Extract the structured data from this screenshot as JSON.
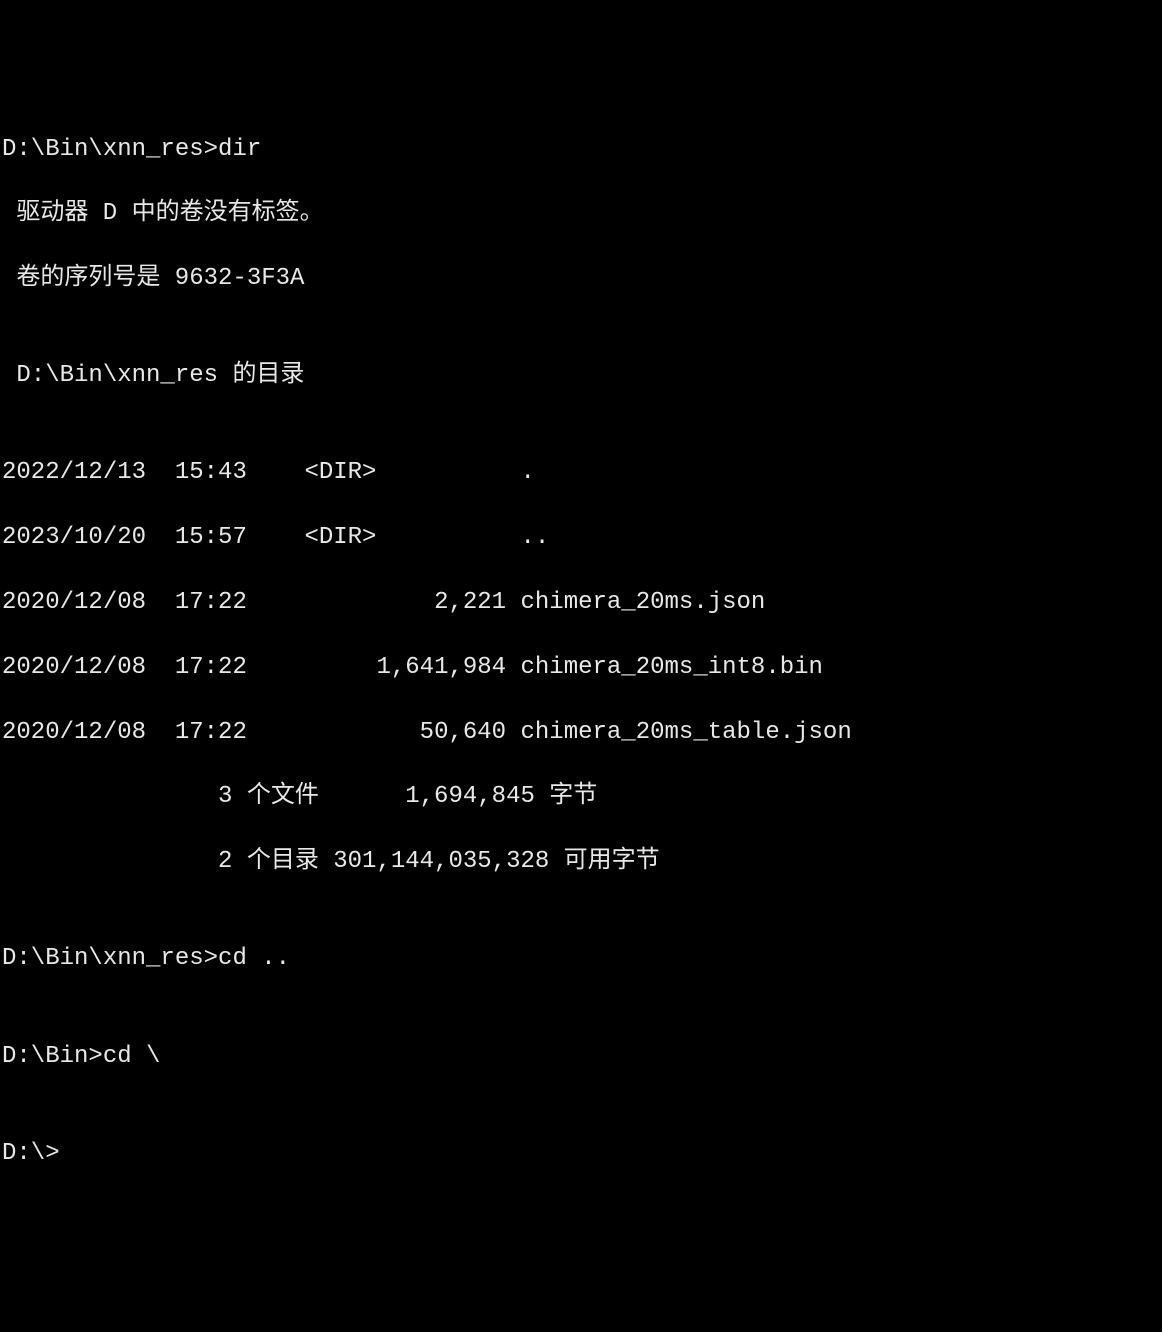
{
  "prompts": {
    "p1_path": "D:\\Bin\\xnn_res>",
    "p1_cmd": "dir",
    "p2_path": "D:\\Bin\\xnn_res>",
    "p2_cmd": "cd ..",
    "p3_path": "D:\\Bin>",
    "p3_cmd": "cd \\",
    "p4_path": "D:\\>",
    "p4_cmd": ""
  },
  "dir_output": {
    "volume_line": " 驱动器 D 中的卷没有标签。",
    "serial_line": " 卷的序列号是 9632-3F3A",
    "blank": "",
    "dir_of_line": " D:\\Bin\\xnn_res 的目录",
    "entries": [
      "2022/12/13  15:43    <DIR>          .",
      "2023/10/20  15:57    <DIR>          ..",
      "2020/12/08  17:22             2,221 chimera_20ms.json",
      "2020/12/08  17:22         1,641,984 chimera_20ms_int8.bin",
      "2020/12/08  17:22            50,640 chimera_20ms_table.json"
    ],
    "summary_files": "               3 个文件      1,694,845 字节",
    "summary_dirs": "               2 个目录 301,144,035,328 可用字节"
  }
}
